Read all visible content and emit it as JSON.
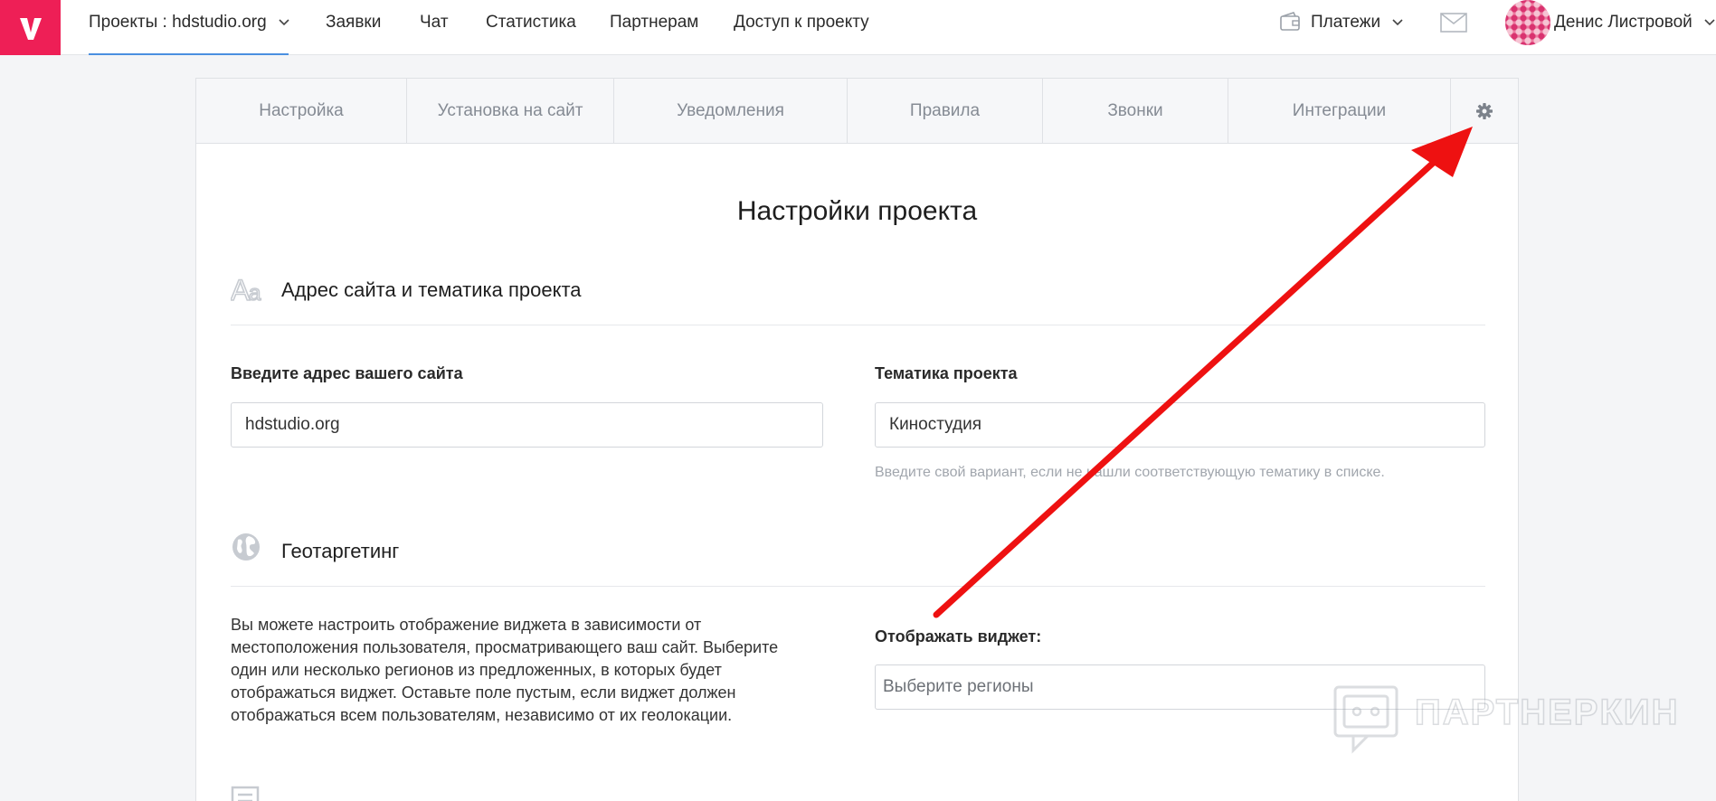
{
  "header": {
    "nav": [
      {
        "label": "Проекты : hdstudio.org"
      },
      {
        "label": "Заявки"
      },
      {
        "label": "Чат"
      },
      {
        "label": "Статистика"
      },
      {
        "label": "Партнерам"
      },
      {
        "label": "Доступ к проекту"
      }
    ],
    "payments_label": "Платежи",
    "user_name": "Денис Листровой"
  },
  "tabs": [
    "Настройка",
    "Установка на сайт",
    "Уведомления",
    "Правила",
    "Звонки",
    "Интеграции"
  ],
  "page_title": "Настройки проекта",
  "section_site": {
    "title": "Адрес сайта и тематика проекта",
    "site_label": "Введите адрес вашего сайта",
    "site_value": "hdstudio.org",
    "topic_label": "Тематика проекта",
    "topic_value": "Киностудия",
    "topic_hint": "Введите свой вариант, если не нашли соответствующую тематику в списке."
  },
  "section_geo": {
    "title": "Геотаргетинг",
    "description": "Вы можете настроить отображение виджета в зависимости от местоположения пользователя, просматривающего ваш сайт. Выберите один или несколько регионов из предложенных, в которых будет отображаться виджет. Оставьте поле пустым, если виджет должен отображаться всем пользователям, независимо от их геолокации.",
    "show_label": "Отображать виджет:",
    "regions_placeholder": "Выберите регионы"
  },
  "watermark": "ПАРТНЕРКИН",
  "colors": {
    "brand": "#ee1f56",
    "arrow": "#ee1111",
    "active_tab_underline": "#4a8fe0"
  }
}
